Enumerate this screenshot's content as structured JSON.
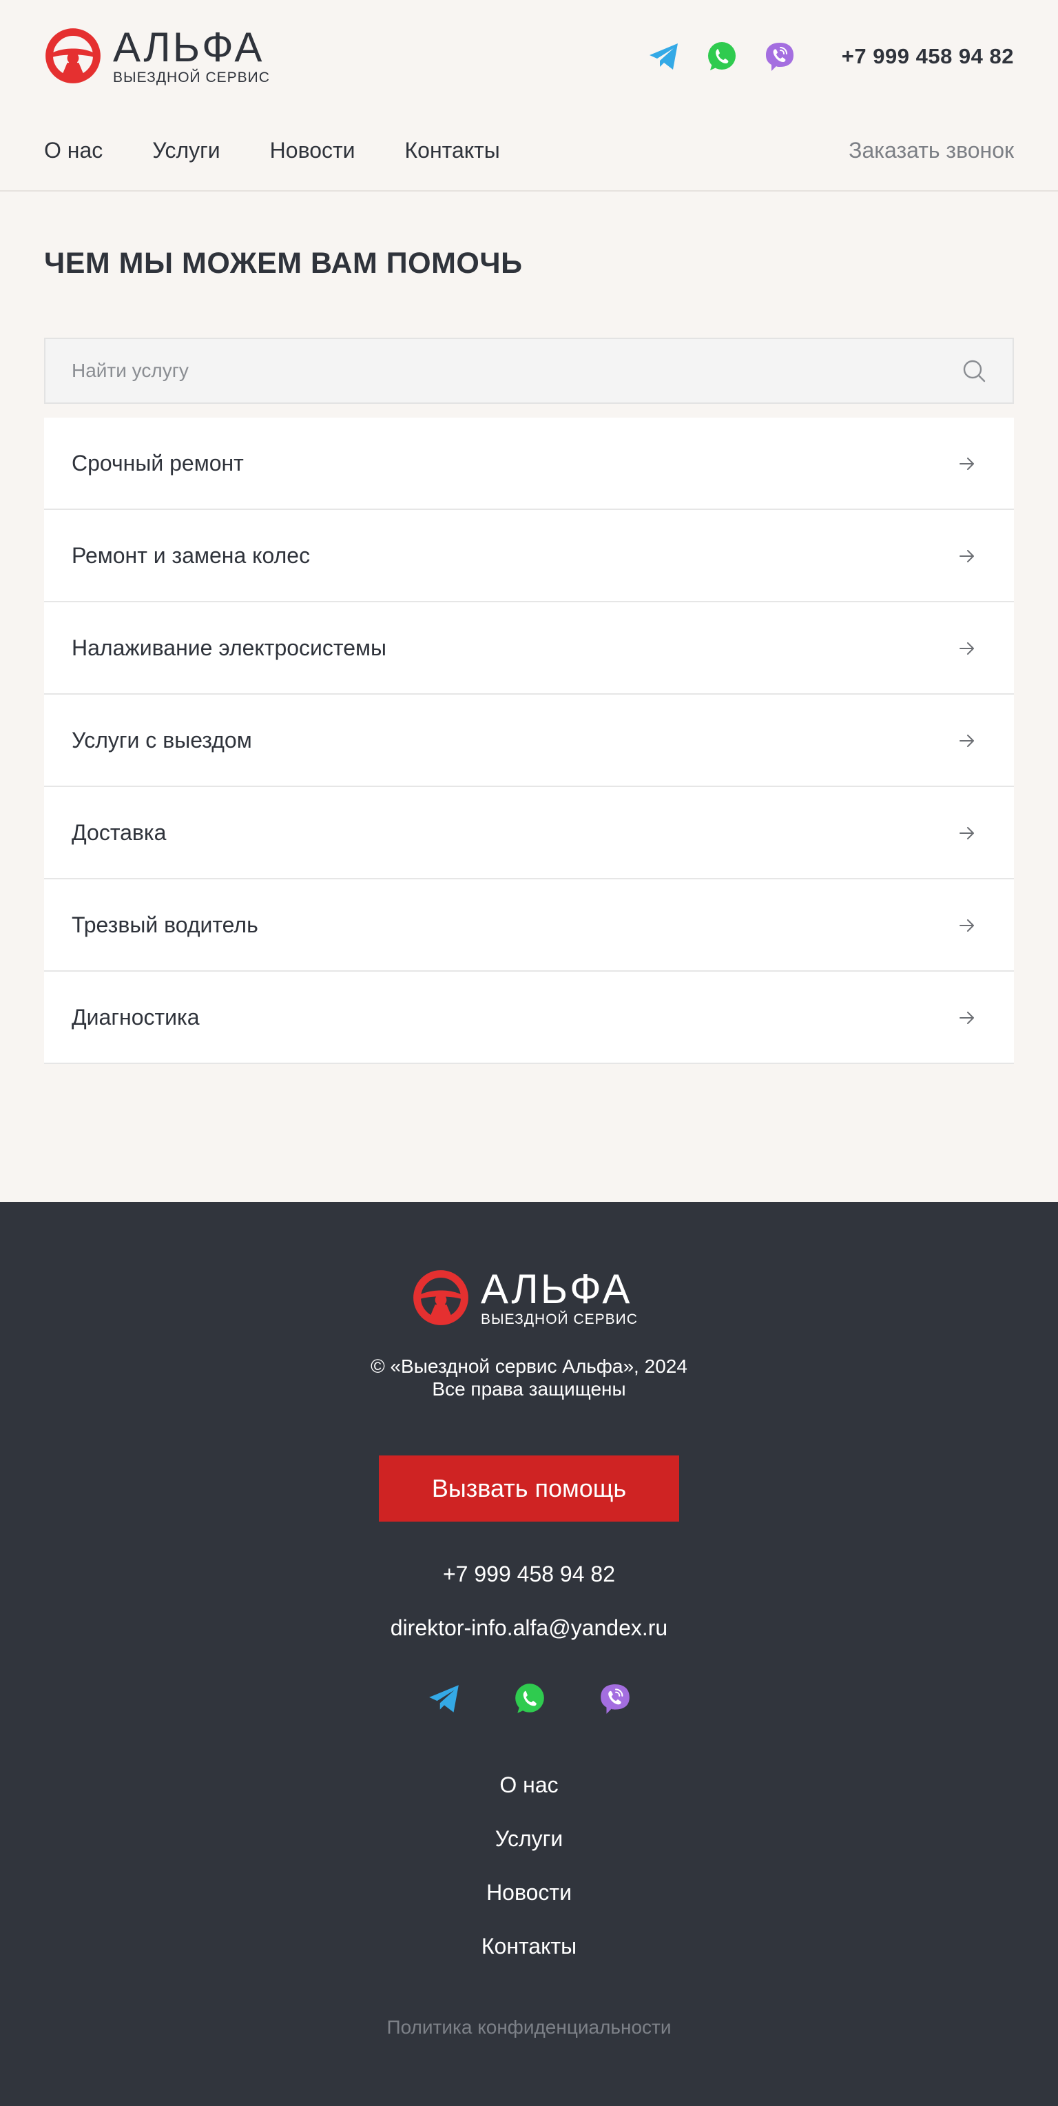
{
  "brand": {
    "name": "АЛЬФА",
    "tagline": "ВЫЕЗДНОЙ СЕРВИС",
    "colors": {
      "accent": "#cf2323",
      "dark": "#31353d",
      "background": "#f8f5f2"
    }
  },
  "header": {
    "social": [
      {
        "name": "telegram",
        "icon": "telegram-icon"
      },
      {
        "name": "whatsapp",
        "icon": "whatsapp-icon"
      },
      {
        "name": "viber",
        "icon": "viber-icon"
      }
    ],
    "phone": "+7 999 458 94 82",
    "nav": [
      {
        "label": "О нас"
      },
      {
        "label": "Услуги"
      },
      {
        "label": "Новости"
      },
      {
        "label": "Контакты"
      }
    ],
    "callback_label": "Заказать звонок"
  },
  "main": {
    "title": "ЧЕМ МЫ МОЖЕМ ВАМ ПОМОЧЬ",
    "search": {
      "placeholder": "Найти услугу",
      "value": ""
    },
    "services": [
      {
        "label": "Срочный ремонт"
      },
      {
        "label": "Ремонт и замена колес"
      },
      {
        "label": "Налаживание электросистемы"
      },
      {
        "label": "Услуги с выездом"
      },
      {
        "label": "Доставка"
      },
      {
        "label": "Трезвый водитель"
      },
      {
        "label": "Диагностика"
      }
    ]
  },
  "footer": {
    "copyright_line1": "© «Выездной сервис Альфа», 2024",
    "copyright_line2": "Все права защищены",
    "cta_label": "Вызвать помощь",
    "phone": "+7 999 458 94 82",
    "email": "direktor-info.alfa@yandex.ru",
    "nav": [
      {
        "label": "О нас"
      },
      {
        "label": "Услуги"
      },
      {
        "label": "Новости"
      },
      {
        "label": "Контакты"
      }
    ],
    "policy_label": "Политика конфиденциальности"
  }
}
